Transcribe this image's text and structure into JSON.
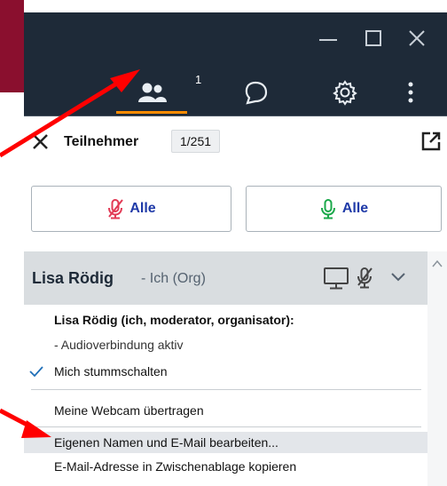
{
  "toolbar": {
    "participants_badge": "1",
    "participants_icon": "people-icon",
    "chat_icon": "chat-bubble-icon",
    "settings_icon": "gear-icon",
    "more_icon": "more-vertical-icon"
  },
  "panel": {
    "title": "Teilnehmer",
    "count": "1/251",
    "mute_all_label": "Alle",
    "unmute_all_label": "Alle"
  },
  "user": {
    "name": "Lisa Rödig",
    "role": "- Ich (Org)"
  },
  "menu": {
    "heading": "Lisa Rödig (ich, moderator, organisator):",
    "audio_status": "- Audioverbindung aktiv",
    "mute_self": "Mich stummschalten",
    "webcam": "Meine Webcam übertragen",
    "edit_name": "Eigenen Namen und E-Mail bearbeiten...",
    "copy_email": "E-Mail-Adresse in Zwischenablage kopieren"
  },
  "colors": {
    "accent_orange": "#ff8c00",
    "mute_red": "#e23a55",
    "unmute_green": "#1aa84a",
    "link_blue": "#1f3aa8",
    "arrow_red": "#ff0000"
  }
}
